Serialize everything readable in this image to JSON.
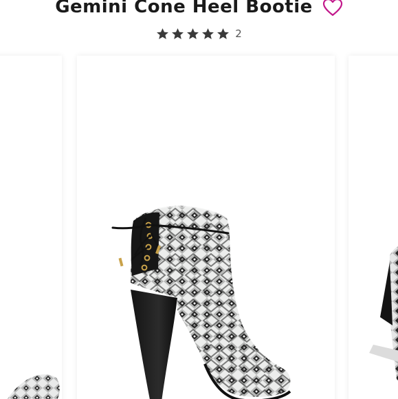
{
  "product": {
    "title": "Gemini Cone Heel Bootie",
    "rating": 5,
    "rating_max": 5,
    "review_count": "2"
  },
  "icons": {
    "wishlist": "heart-outline-icon",
    "star": "star-icon"
  },
  "colors": {
    "wishlist_accent": "#c2188b",
    "star_fill": "#3a3a3a",
    "title_text": "#1a1a1a"
  },
  "carousel": {
    "slides": [
      {
        "name": "previous-product-image"
      },
      {
        "name": "current-product-image"
      },
      {
        "name": "next-product-image"
      }
    ],
    "active_index": 1
  }
}
